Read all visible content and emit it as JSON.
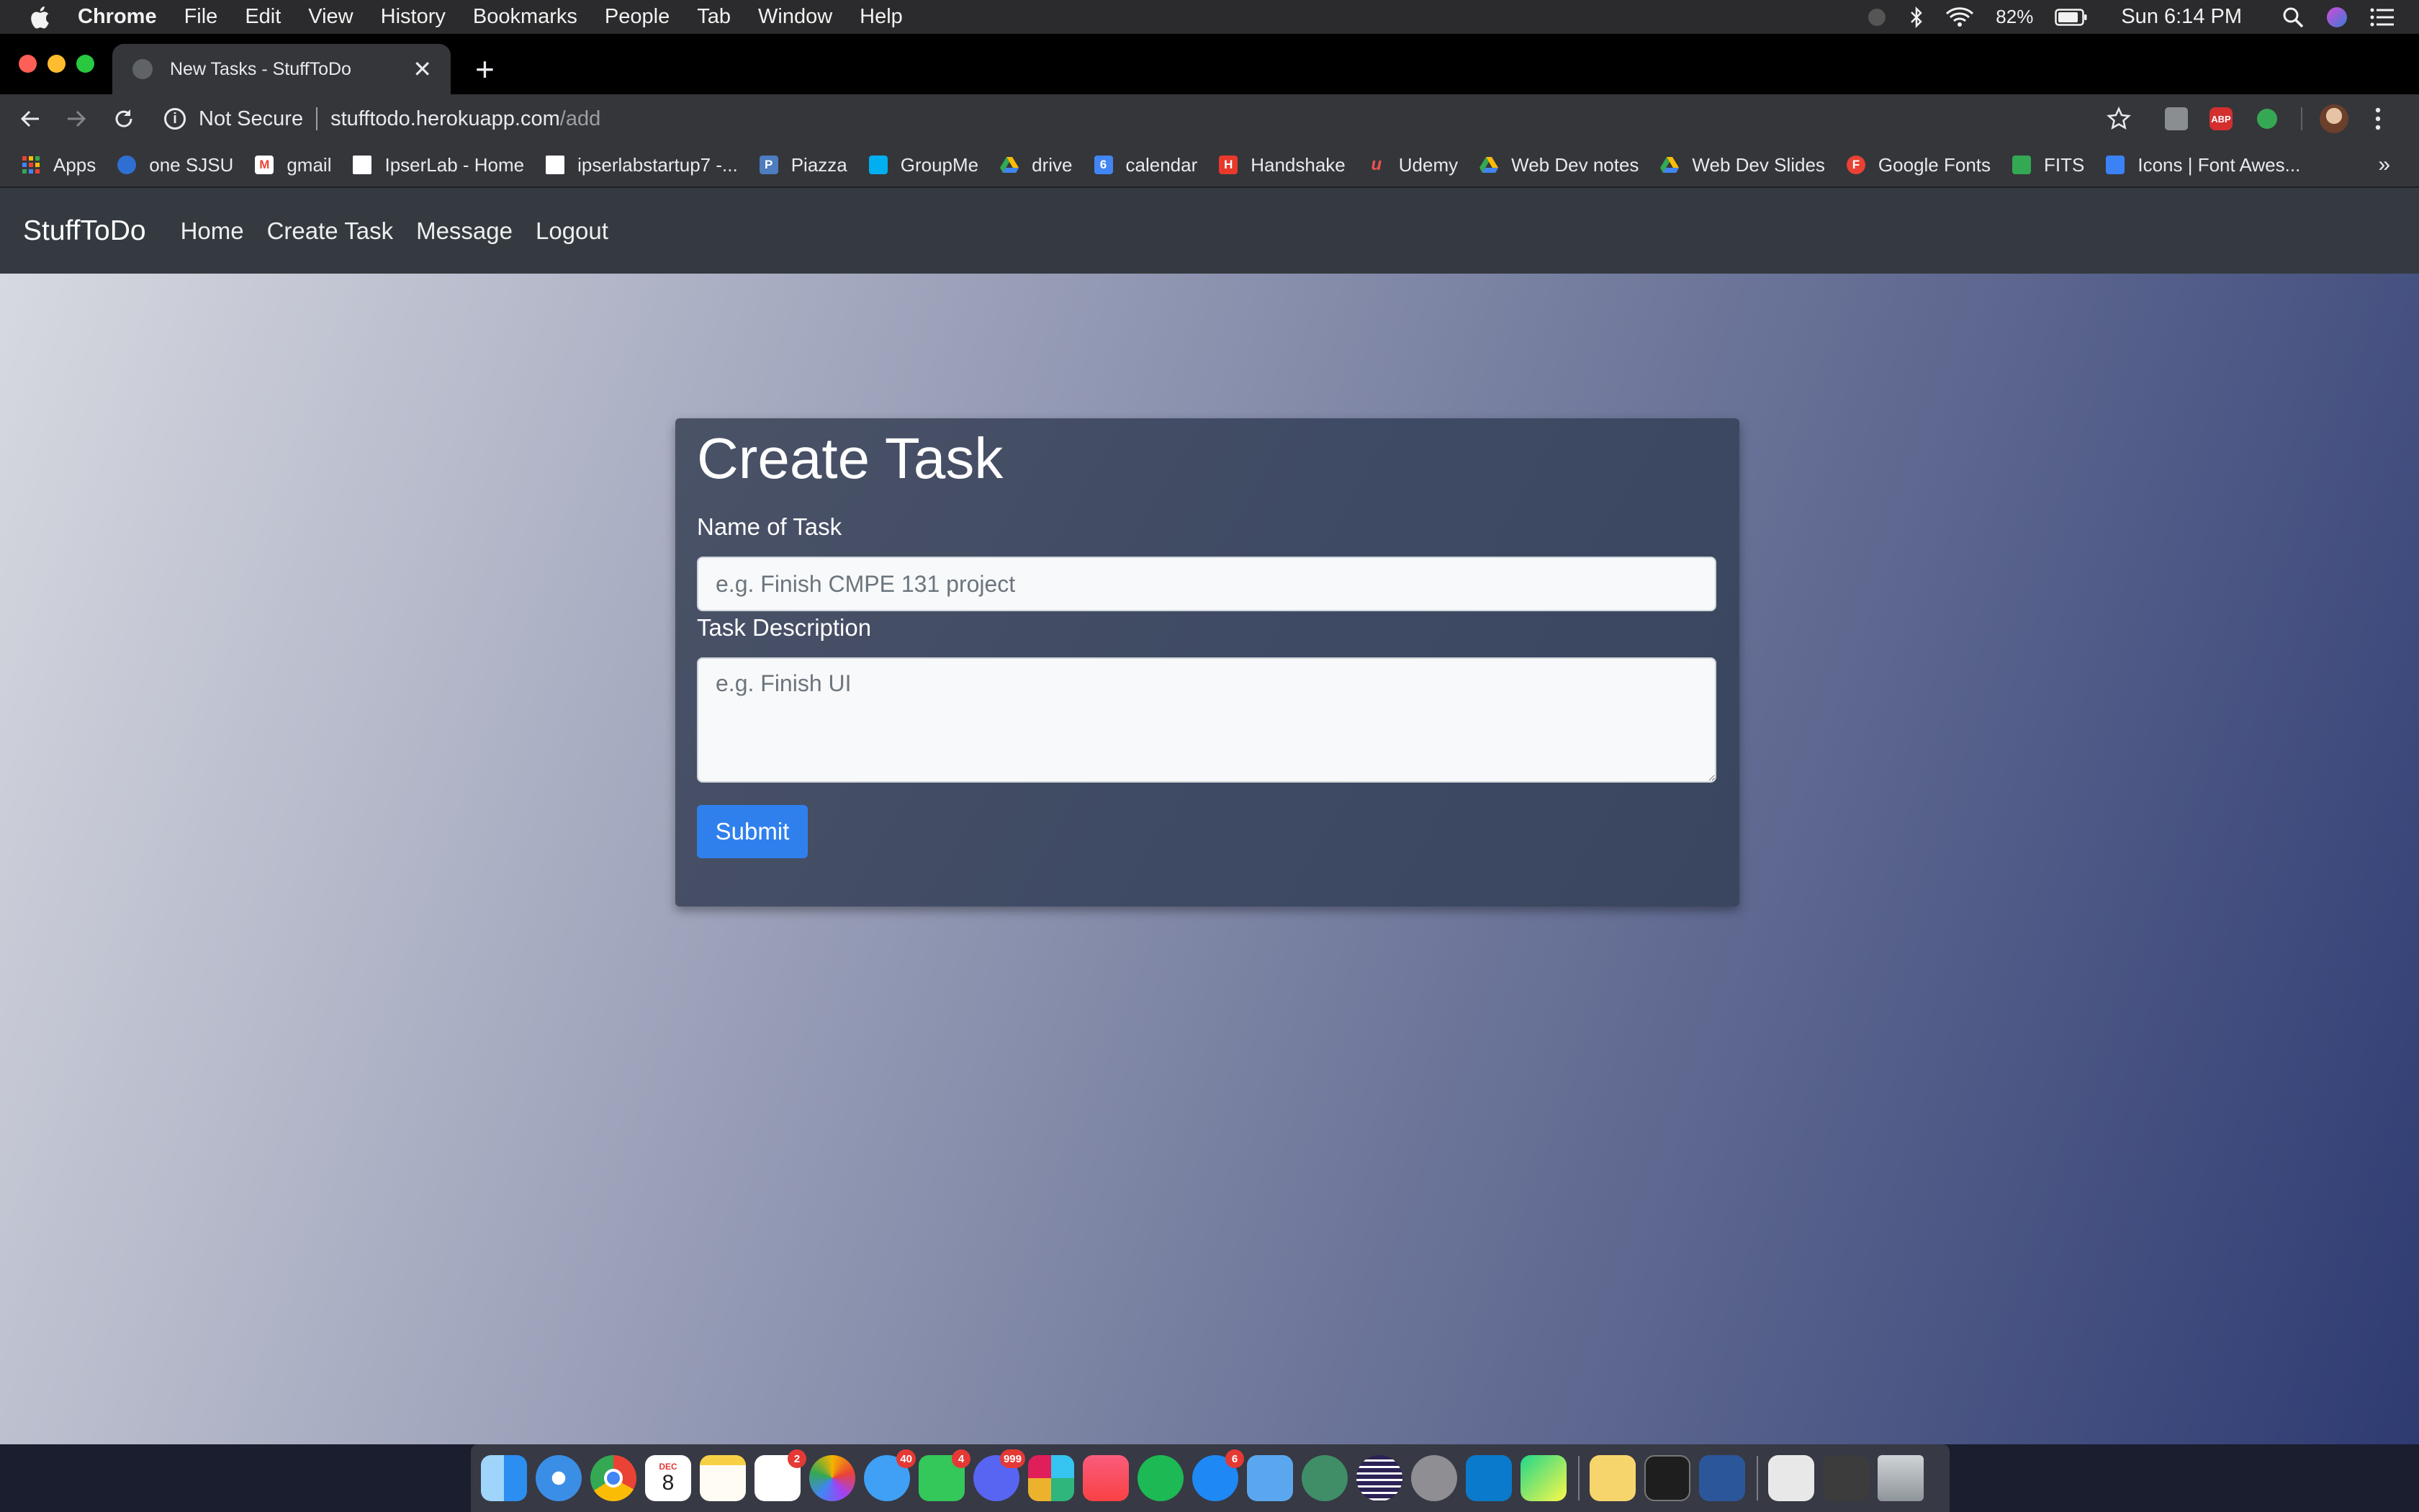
{
  "menubar": {
    "app_name": "Chrome",
    "menus": [
      "File",
      "Edit",
      "View",
      "History",
      "Bookmarks",
      "People",
      "Tab",
      "Window",
      "Help"
    ],
    "battery": "82%",
    "clock": "Sun 6:14 PM"
  },
  "tab": {
    "title": "New Tasks - StuffToDo",
    "close": "✕",
    "new_tab": "+"
  },
  "omnibox": {
    "security": "Not Secure",
    "host": "stufftodo.herokuapp.com",
    "path": "/add"
  },
  "bookmarks": {
    "items": [
      {
        "label": "Apps",
        "icon_color": "#e8710a",
        "glyph": ""
      },
      {
        "label": "one SJSU",
        "icon_color": "#2f6fd1",
        "glyph": ""
      },
      {
        "label": "gmail",
        "icon_color": "#ea4335",
        "glyph": "M"
      },
      {
        "label": "IpserLab - Home",
        "icon_color": "#ffffff",
        "glyph": ""
      },
      {
        "label": "ipserlabstartup7 -...",
        "icon_color": "#ffffff",
        "glyph": ""
      },
      {
        "label": "Piazza",
        "icon_color": "#4d7cbf",
        "glyph": "P"
      },
      {
        "label": "GroupMe",
        "icon_color": "#00aff0",
        "glyph": ""
      },
      {
        "label": "drive",
        "icon_color": "#1fa463",
        "glyph": ""
      },
      {
        "label": "calendar",
        "icon_color": "#4285f4",
        "glyph": "6"
      },
      {
        "label": "Handshake",
        "icon_color": "#e8392b",
        "glyph": "H"
      },
      {
        "label": "Udemy",
        "icon_color": "#35363a",
        "glyph": "u"
      },
      {
        "label": "Web Dev notes",
        "icon_color": "#1fa463",
        "glyph": ""
      },
      {
        "label": "Web Dev Slides",
        "icon_color": "#f4b400",
        "glyph": ""
      },
      {
        "label": "Google Fonts",
        "icon_color": "#e94235",
        "glyph": "F"
      },
      {
        "label": "FITS",
        "icon_color": "#34a853",
        "glyph": ""
      },
      {
        "label": "Icons | Font Awes...",
        "icon_color": "#3b82f6",
        "glyph": ""
      }
    ],
    "more": "»"
  },
  "navbar": {
    "brand": "StuffToDo",
    "links": [
      "Home",
      "Create Task",
      "Message",
      "Logout"
    ]
  },
  "form": {
    "title": "Create Task",
    "name_label": "Name of Task",
    "name_placeholder": "e.g. Finish CMPE 131 project",
    "name_value": "",
    "desc_label": "Task Description",
    "desc_placeholder": "e.g. Finish UI",
    "desc_value": "",
    "submit": "Submit"
  },
  "dock": {
    "calendar_month": "DEC",
    "calendar_day": "8",
    "badges": {
      "reminders": "2",
      "messages": "40",
      "facetime": "4",
      "discord": "999",
      "appstore": "6"
    }
  },
  "colors": {
    "accent": "#2f80ed",
    "navbar": "#343a40",
    "card": "#3f4a64"
  }
}
